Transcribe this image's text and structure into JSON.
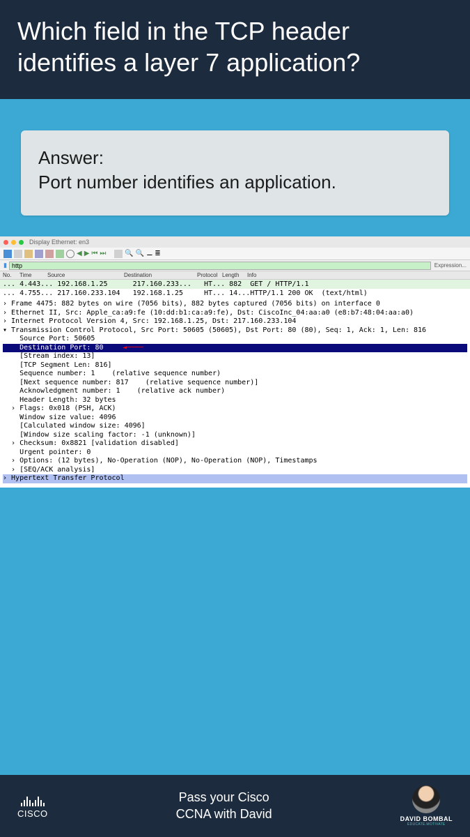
{
  "header": {
    "question": "Which field in the TCP header identifies a layer 7 application?"
  },
  "answer": {
    "label": "Answer:",
    "text": "Port number identifies an application."
  },
  "wireshark": {
    "title": "Display Ethernet: en3",
    "filter": "http",
    "expression_label": "Expression...",
    "cols": [
      "No.",
      "Time",
      "Source",
      "Destination",
      "Protocol",
      "Length",
      "Info"
    ],
    "packets": [
      {
        "no": "...",
        "time": "4.443...",
        "src": "192.168.1.25",
        "dst": "217.160.233...",
        "proto": "HT...",
        "len": "882",
        "info": "GET / HTTP/1.1",
        "cls": "green"
      },
      {
        "no": "...",
        "time": "4.755...",
        "src": "217.160.233.104",
        "dst": "192.168.1.25",
        "proto": "HT...",
        "len": "14...",
        "info": "HTTP/1.1 200 OK  (text/html)",
        "cls": "white"
      }
    ],
    "details": [
      {
        "t": "› Frame 4475: 882 bytes on wire (7056 bits), 882 bytes captured (7056 bits) on interface 0"
      },
      {
        "t": "› Ethernet II, Src: Apple_ca:a9:fe (10:dd:b1:ca:a9:fe), Dst: CiscoInc_04:aa:a0 (e8:b7:48:04:aa:a0)"
      },
      {
        "t": "› Internet Protocol Version 4, Src: 192.168.1.25, Dst: 217.160.233.104"
      },
      {
        "t": "▾ Transmission Control Protocol, Src Port: 50605 (50605), Dst Port: 80 (80), Seq: 1, Ack: 1, Len: 816"
      },
      {
        "t": "    Source Port: 50605"
      },
      {
        "t": "    Destination Port: 80",
        "sel": true,
        "arrow": true
      },
      {
        "t": "    [Stream index: 13]"
      },
      {
        "t": "    [TCP Segment Len: 816]"
      },
      {
        "t": "    Sequence number: 1    (relative sequence number)"
      },
      {
        "t": "    [Next sequence number: 817    (relative sequence number)]"
      },
      {
        "t": "    Acknowledgment number: 1    (relative ack number)"
      },
      {
        "t": "    Header Length: 32 bytes"
      },
      {
        "t": "  › Flags: 0x018 (PSH, ACK)"
      },
      {
        "t": "    Window size value: 4096"
      },
      {
        "t": "    [Calculated window size: 4096]"
      },
      {
        "t": "    [Window size scaling factor: -1 (unknown)]"
      },
      {
        "t": "  › Checksum: 0x8821 [validation disabled]"
      },
      {
        "t": "    Urgent pointer: 0"
      },
      {
        "t": "  › Options: (12 bytes), No-Operation (NOP), No-Operation (NOP), Timestamps"
      },
      {
        "t": "  › [SEQ/ACK analysis]"
      },
      {
        "t": "› Hypertext Transfer Protocol",
        "hyper": true
      }
    ]
  },
  "footer": {
    "cisco": "CISCO",
    "line1": "Pass your Cisco",
    "line2": "CCNA with David",
    "david_name": "DAVID BOMBAL",
    "david_tag": "EDUCATE.MOTIVATE"
  }
}
